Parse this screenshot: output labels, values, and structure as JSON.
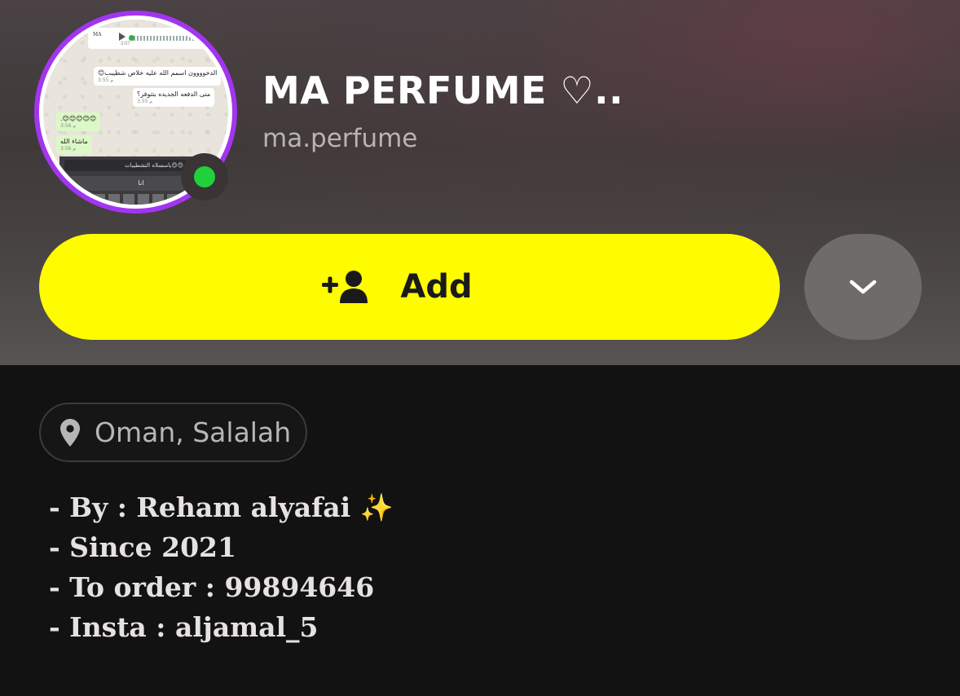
{
  "profile": {
    "display_name": "MA PERFUME ♡..",
    "username": "ma.perfume",
    "status": "online"
  },
  "avatar": {
    "voice_brand": "MA",
    "voice_time": "3:07",
    "messages": [
      {
        "text": "الدخوووون اسمم الله عليه خلاص شطيبب😊",
        "time": "3:55 م"
      },
      {
        "text": "متى الدفعه الجديده بتتوفر؟",
        "time": "3:55 م"
      },
      {
        "text": "😊😊😊😊😊.",
        "time": "3:56 م"
      },
      {
        "text": "ماشاء الله",
        "time": "3:56 م"
      }
    ],
    "keyboard_input": "ياسسلاه التشطيبات😊😊",
    "keyboard_suggestion": "انا"
  },
  "actions": {
    "add_label": "Add",
    "add_icon": "add-friend-icon",
    "more_icon": "chevron-down-icon"
  },
  "location": {
    "icon": "location-pin-icon",
    "text": "Oman, Salalah"
  },
  "bio": {
    "line1": "- By : Reham alyafai",
    "line1_emoji": "✨",
    "line2": "- Since 2021",
    "line3": "- To order : 99894646",
    "line4": "- Insta : aljamal_5"
  },
  "colors": {
    "add_button": "#fffc00",
    "story_ring": "#a235f0",
    "online": "#1fd13a",
    "background": "#121212"
  }
}
